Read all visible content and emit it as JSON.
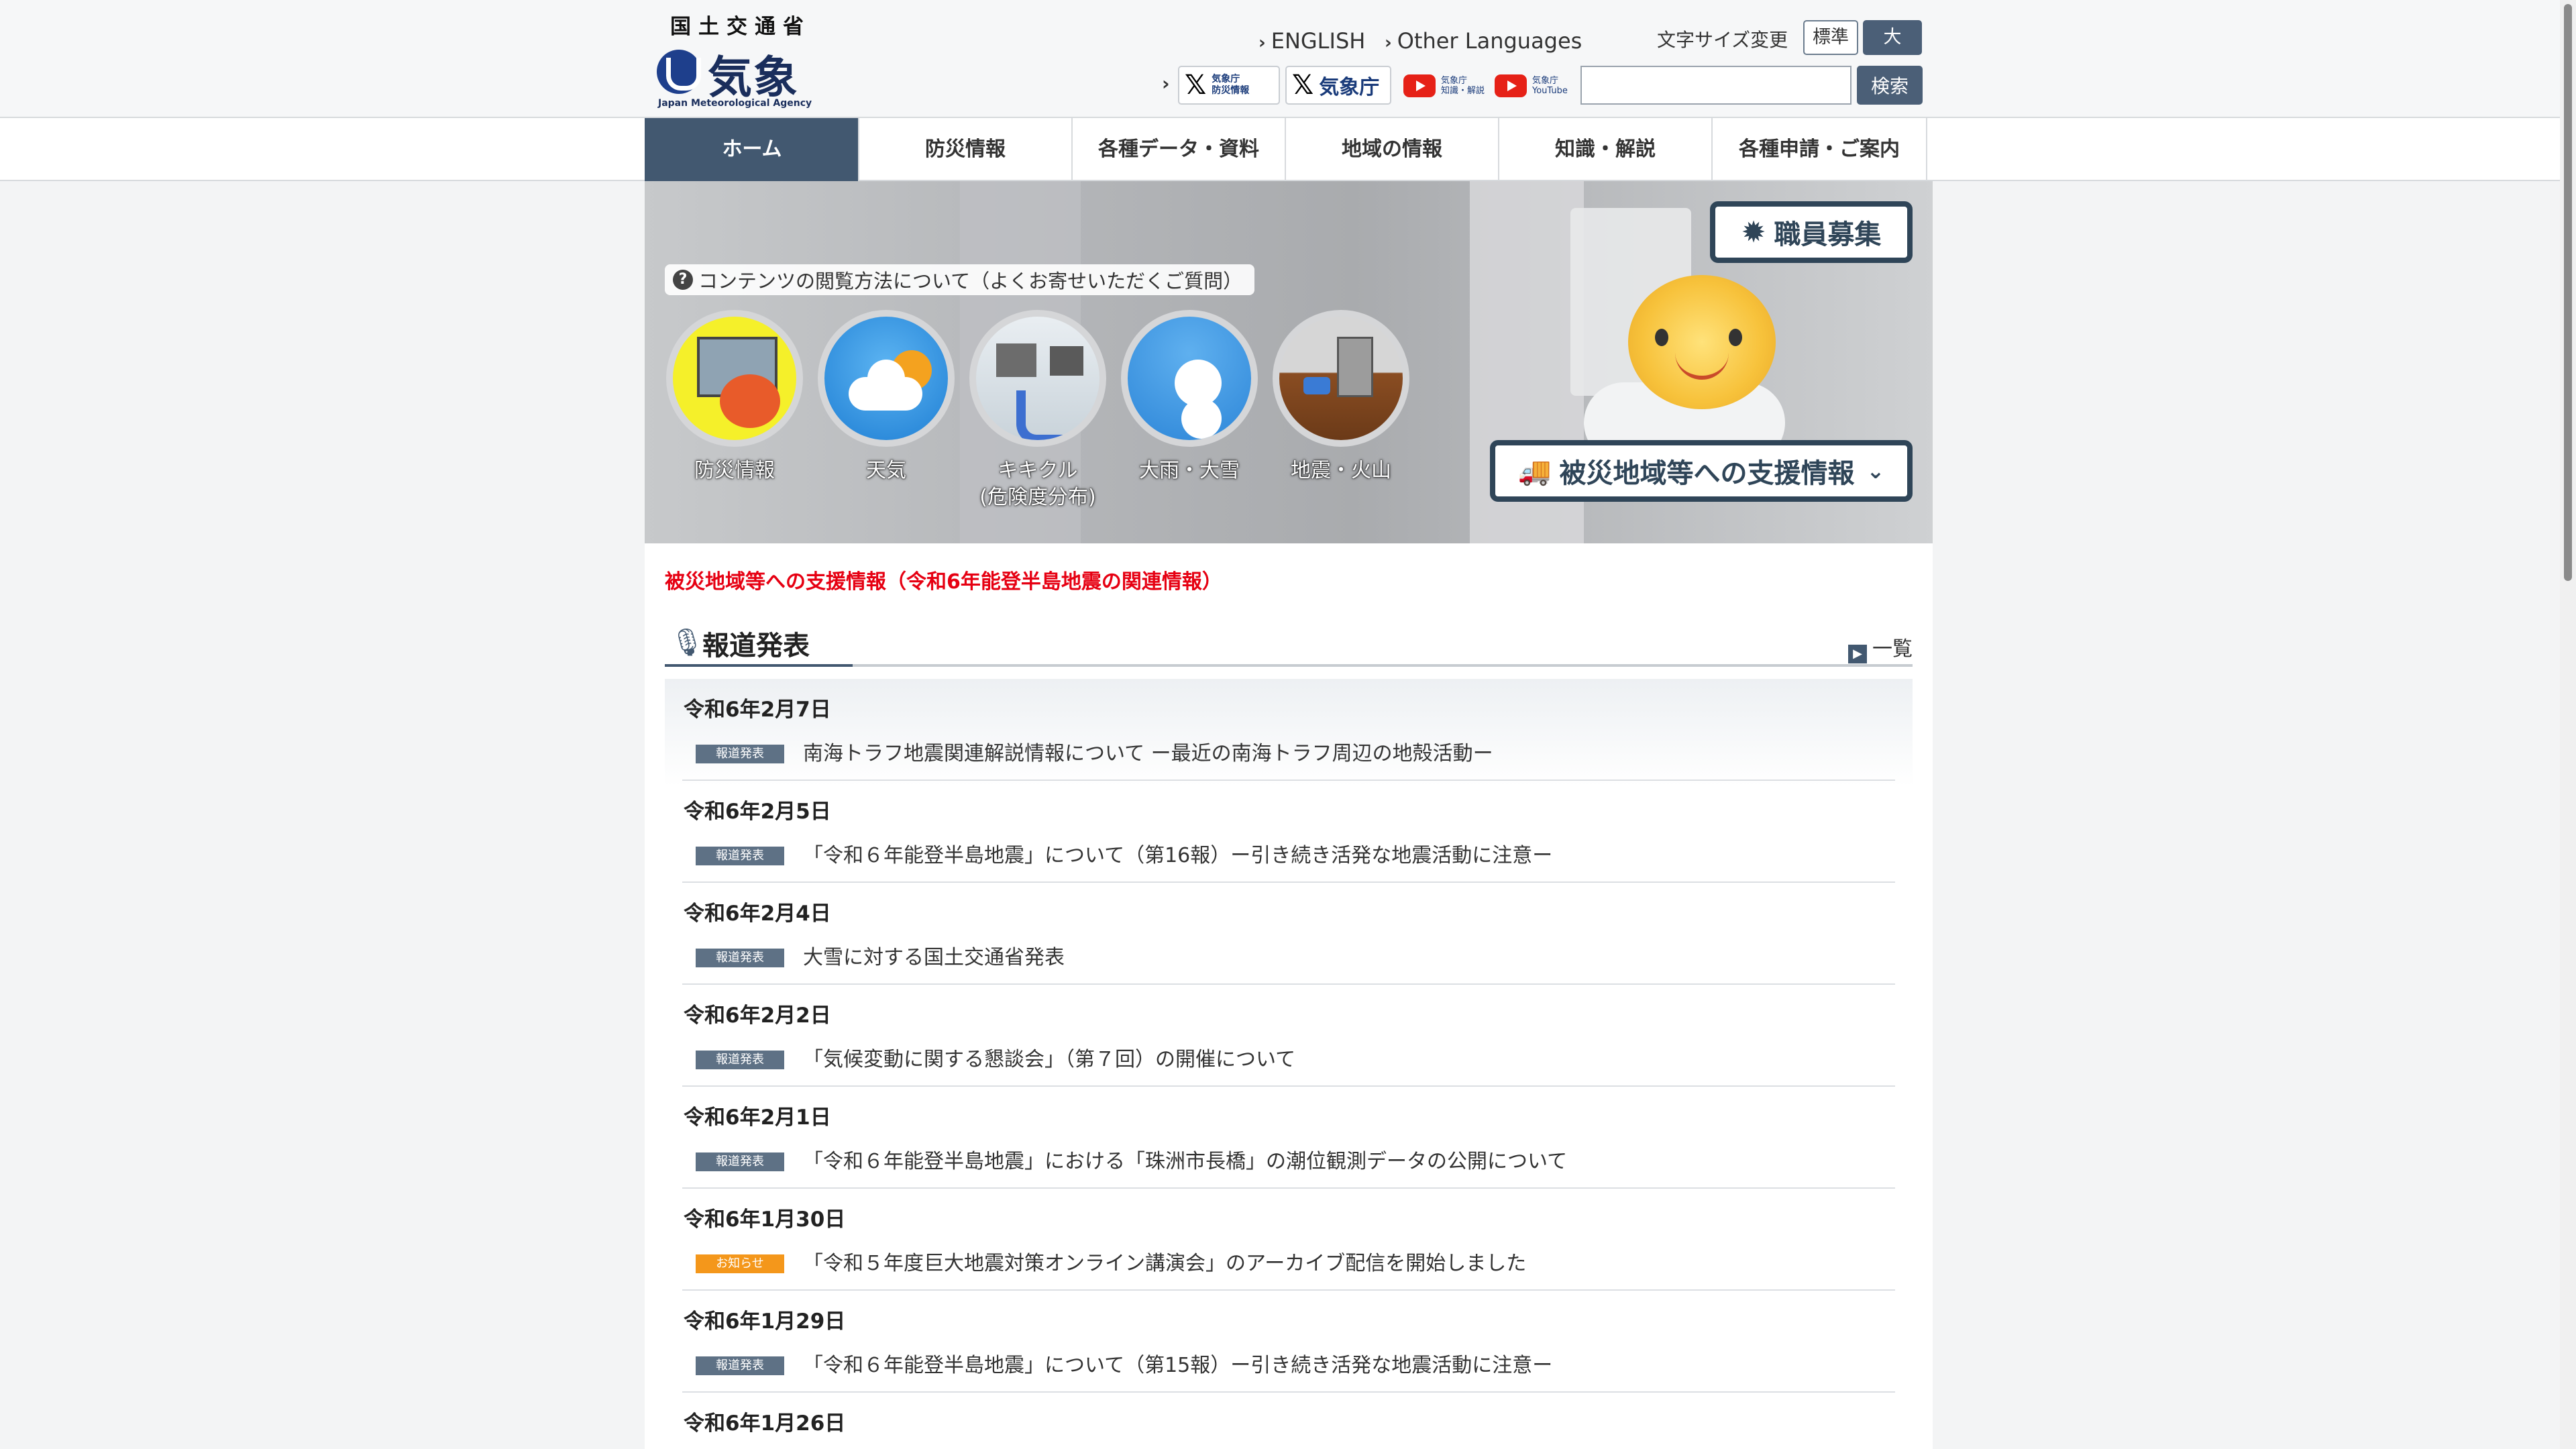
{
  "header": {
    "logo": {
      "ministry": "国土交通省",
      "agency_jp": "気象庁",
      "agency_en": "Japan Meteorological Agency"
    },
    "links": {
      "english": "ENGLISH",
      "other_languages": "Other Languages"
    },
    "font_size": {
      "label": "文字サイズ変更",
      "standard": "標準",
      "large": "大"
    },
    "sns": {
      "x_bousai_line1": "気象庁",
      "x_bousai_line2": "防災情報",
      "x_main": "気象庁",
      "yt_chishiki_line1": "気象庁",
      "yt_chishiki_line2": "知識・解説",
      "yt_main_line1": "気象庁",
      "yt_main_line2": "YouTube"
    },
    "search": {
      "value": "",
      "button": "検索"
    }
  },
  "nav": {
    "items": [
      {
        "label": "ホーム",
        "active": true
      },
      {
        "label": "防災情報"
      },
      {
        "label": "各種データ・資料"
      },
      {
        "label": "地域の情報"
      },
      {
        "label": "知識・解説"
      },
      {
        "label": "各種申請・ご案内"
      }
    ]
  },
  "hero": {
    "faq": "コンテンツの閲覧方法について（よくお寄せいただくご質問）",
    "buttons": [
      {
        "label": "防災情報",
        "icon": "bousai-icon"
      },
      {
        "label": "天気",
        "icon": "weather-icon"
      },
      {
        "label": "キキクル",
        "sub": "(危険度分布)",
        "icon": "kikikuru-icon"
      },
      {
        "label": "大雨・大雪",
        "icon": "heavy-rain-snow-icon"
      },
      {
        "label": "地震・火山",
        "icon": "earthquake-volcano-icon"
      }
    ],
    "recruit": "職員募集",
    "support": "被災地域等への支援情報"
  },
  "main": {
    "alert": "被災地域等への支援情報（令和6年能登半島地震の関連情報）",
    "press": {
      "heading": "報道発表",
      "more": "一覧",
      "items": [
        {
          "date": "令和6年2月7日",
          "tag": "報道発表",
          "title": "南海トラフ地震関連解説情報について ー最近の南海トラフ周辺の地殻活動ー"
        },
        {
          "date": "令和6年2月5日",
          "tag": "報道発表",
          "title": "「令和６年能登半島地震」について（第16報）ー引き続き活発な地震活動に注意ー"
        },
        {
          "date": "令和6年2月4日",
          "tag": "報道発表",
          "title": "大雪に対する国土交通省発表"
        },
        {
          "date": "令和6年2月2日",
          "tag": "報道発表",
          "title": "「気候変動に関する懇談会」（第７回）の開催について"
        },
        {
          "date": "令和6年2月1日",
          "tag": "報道発表",
          "title": "「令和６年能登半島地震」における「珠洲市長橋」の潮位観測データの公開について"
        },
        {
          "date": "令和6年1月30日",
          "tag": "お知らせ",
          "title": "「令和５年度巨大地震対策オンライン講演会」のアーカイブ配信を開始しました"
        },
        {
          "date": "令和6年1月29日",
          "tag": "報道発表",
          "title": "「令和６年能登半島地震」について（第15報）ー引き続き活発な地震活動に注意ー"
        },
        {
          "date": "令和6年1月26日",
          "tag": "",
          "title": ""
        }
      ]
    }
  },
  "colors": {
    "accent": "#425870",
    "alert": "#e60012",
    "notice_tag": "#f4971b",
    "press_tag": "#5e7185"
  }
}
